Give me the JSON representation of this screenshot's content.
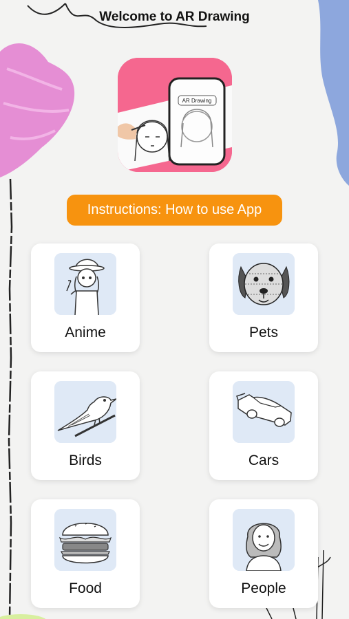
{
  "header": {
    "title": "Welcome to AR Drawing"
  },
  "app_icon": {
    "badge_text": "AR Drawing"
  },
  "instructions_button": {
    "label": "Instructions: How to use App"
  },
  "categories": [
    {
      "label": "Anime",
      "icon": "anime-girl-icon"
    },
    {
      "label": "Pets",
      "icon": "dog-icon"
    },
    {
      "label": "Birds",
      "icon": "bird-icon"
    },
    {
      "label": "Cars",
      "icon": "car-icon"
    },
    {
      "label": "Food",
      "icon": "burger-icon"
    },
    {
      "label": "People",
      "icon": "woman-portrait-icon"
    }
  ],
  "colors": {
    "accent": "#f7930f",
    "brand_pink": "#f5678f",
    "thumb_bg": "#dfe9f6"
  }
}
